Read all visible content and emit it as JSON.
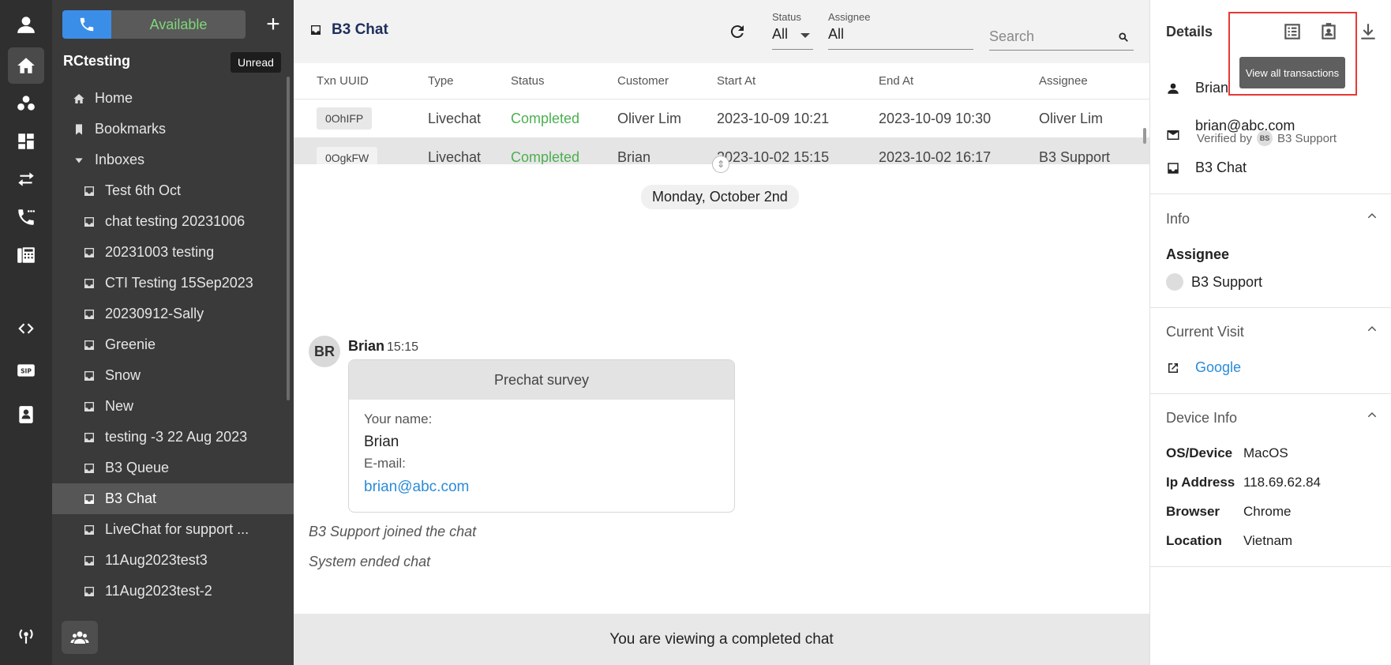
{
  "sidebar": {
    "status": "Available",
    "workspace": "RCtesting",
    "unread_tooltip": "Unread",
    "nav": [
      {
        "label": "Home",
        "icon": "home-icon"
      },
      {
        "label": "Bookmarks",
        "icon": "bookmark-icon"
      },
      {
        "label": "Inboxes",
        "icon": "caret-down-icon"
      }
    ],
    "inboxes": [
      "Test 6th Oct",
      "chat testing 20231006",
      "20231003 testing",
      "CTI Testing 15Sep2023",
      "20230912-Sally",
      "Greenie",
      "Snow",
      "New",
      "testing -3 22 Aug 2023",
      "B3 Queue",
      "B3 Chat",
      "LiveChat for support ...",
      "11Aug2023test3",
      "11Aug2023test-2"
    ],
    "selected_inbox": "B3 Chat"
  },
  "header": {
    "title": "B3 Chat",
    "status_label": "Status",
    "status_value": "All",
    "assignee_label": "Assignee",
    "assignee_value": "All",
    "search_placeholder": "Search"
  },
  "table": {
    "columns": [
      "Txn UUID",
      "Type",
      "Status",
      "Customer",
      "Start At",
      "End At",
      "Assignee"
    ],
    "rows": [
      {
        "uuid": "0OhIFP",
        "type": "Livechat",
        "status": "Completed",
        "customer": "Oliver Lim",
        "start": "2023-10-09 10:21",
        "end": "2023-10-09 10:30",
        "assignee": "Oliver Lim"
      },
      {
        "uuid": "0OgkFW",
        "type": "Livechat",
        "status": "Completed",
        "customer": "Brian",
        "start": "2023-10-02 15:15",
        "end": "2023-10-02 16:17",
        "assignee": "B3 Support"
      }
    ]
  },
  "conversation": {
    "date": "Monday, October 2nd",
    "avatar_initials": "BR",
    "sender": "Brian",
    "time": "15:15",
    "survey": {
      "title": "Prechat survey",
      "name_label": "Your name:",
      "name_value": "Brian",
      "email_label": "E-mail:",
      "email_value": "brian@abc.com"
    },
    "system_lines": [
      "B3 Support joined the chat",
      "System ended chat"
    ],
    "footer": "You are viewing a completed chat"
  },
  "details": {
    "title": "Details",
    "tooltip": "View all transactions",
    "customer_name": "Brian",
    "email": "brian@abc.com",
    "verified_by_label": "Verified by",
    "verified_by_initials": "BS",
    "verified_by_name": "B3 Support",
    "inbox": "B3 Chat",
    "info_title": "Info",
    "assignee_label": "Assignee",
    "assignee_value": "B3 Support",
    "visit_title": "Current Visit",
    "visit_link": "Google",
    "device_title": "Device Info",
    "device": [
      {
        "key": "OS/Device",
        "value": "MacOS"
      },
      {
        "key": "Ip Address",
        "value": "118.69.62.84"
      },
      {
        "key": "Browser",
        "value": "Chrome"
      },
      {
        "key": "Location",
        "value": "Vietnam"
      }
    ]
  },
  "colors": {
    "accent": "#3b8ee8",
    "available": "#7fd67a",
    "completed": "#4caf50",
    "highlight": "#e53935",
    "link": "#2a8bd8"
  }
}
